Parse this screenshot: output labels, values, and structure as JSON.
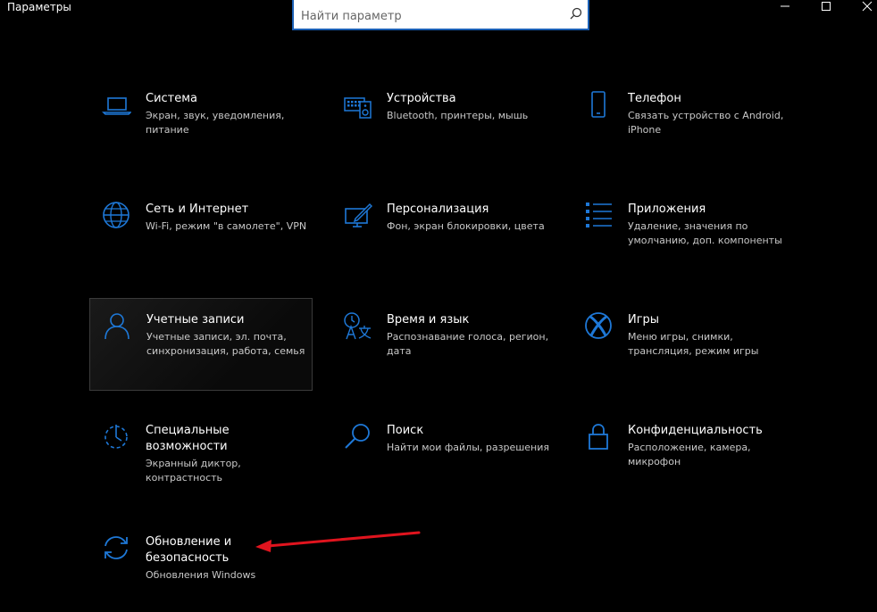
{
  "window": {
    "title": "Параметры"
  },
  "search": {
    "placeholder": "Найти параметр"
  },
  "tiles": [
    {
      "name": "Система",
      "desc": "Экран, звук, уведомления, питание"
    },
    {
      "name": "Устройства",
      "desc": "Bluetooth, принтеры, мышь"
    },
    {
      "name": "Телефон",
      "desc": "Связать устройство с Android, iPhone"
    },
    {
      "name": "Сеть и Интернет",
      "desc": "Wi-Fi, режим \"в самолете\", VPN"
    },
    {
      "name": "Персонализация",
      "desc": "Фон, экран блокировки, цвета"
    },
    {
      "name": "Приложения",
      "desc": "Удаление, значения по умолчанию, доп. компоненты"
    },
    {
      "name": "Учетные записи",
      "desc": "Учетные записи, эл. почта, синхронизация, работа, семья"
    },
    {
      "name": "Время и язык",
      "desc": "Распознавание голоса, регион, дата"
    },
    {
      "name": "Игры",
      "desc": "Меню игры, снимки, трансляция, режим игры"
    },
    {
      "name": "Специальные возможности",
      "desc": "Экранный диктор, контрастность"
    },
    {
      "name": "Поиск",
      "desc": "Найти мои файлы, разрешения"
    },
    {
      "name": "Конфиденциальность",
      "desc": "Расположение, камера, микрофон"
    },
    {
      "name": "Обновление и безопасность",
      "desc": "Обновления Windows"
    }
  ],
  "colors": {
    "accent": "#1e78d7",
    "background": "#000000",
    "annotation_arrow": "#e0141e"
  },
  "icons": {
    "system": "laptop-icon",
    "devices": "keyboard-speaker-icon",
    "phone": "phone-icon",
    "network": "globe-icon",
    "personalization": "paint-brush-icon",
    "apps": "apps-list-icon",
    "accounts": "person-icon",
    "time": "time-language-icon",
    "gaming": "xbox-icon",
    "ease": "accessibility-timer-icon",
    "search": "magnifier-icon",
    "privacy": "lock-icon",
    "update": "sync-icon"
  }
}
